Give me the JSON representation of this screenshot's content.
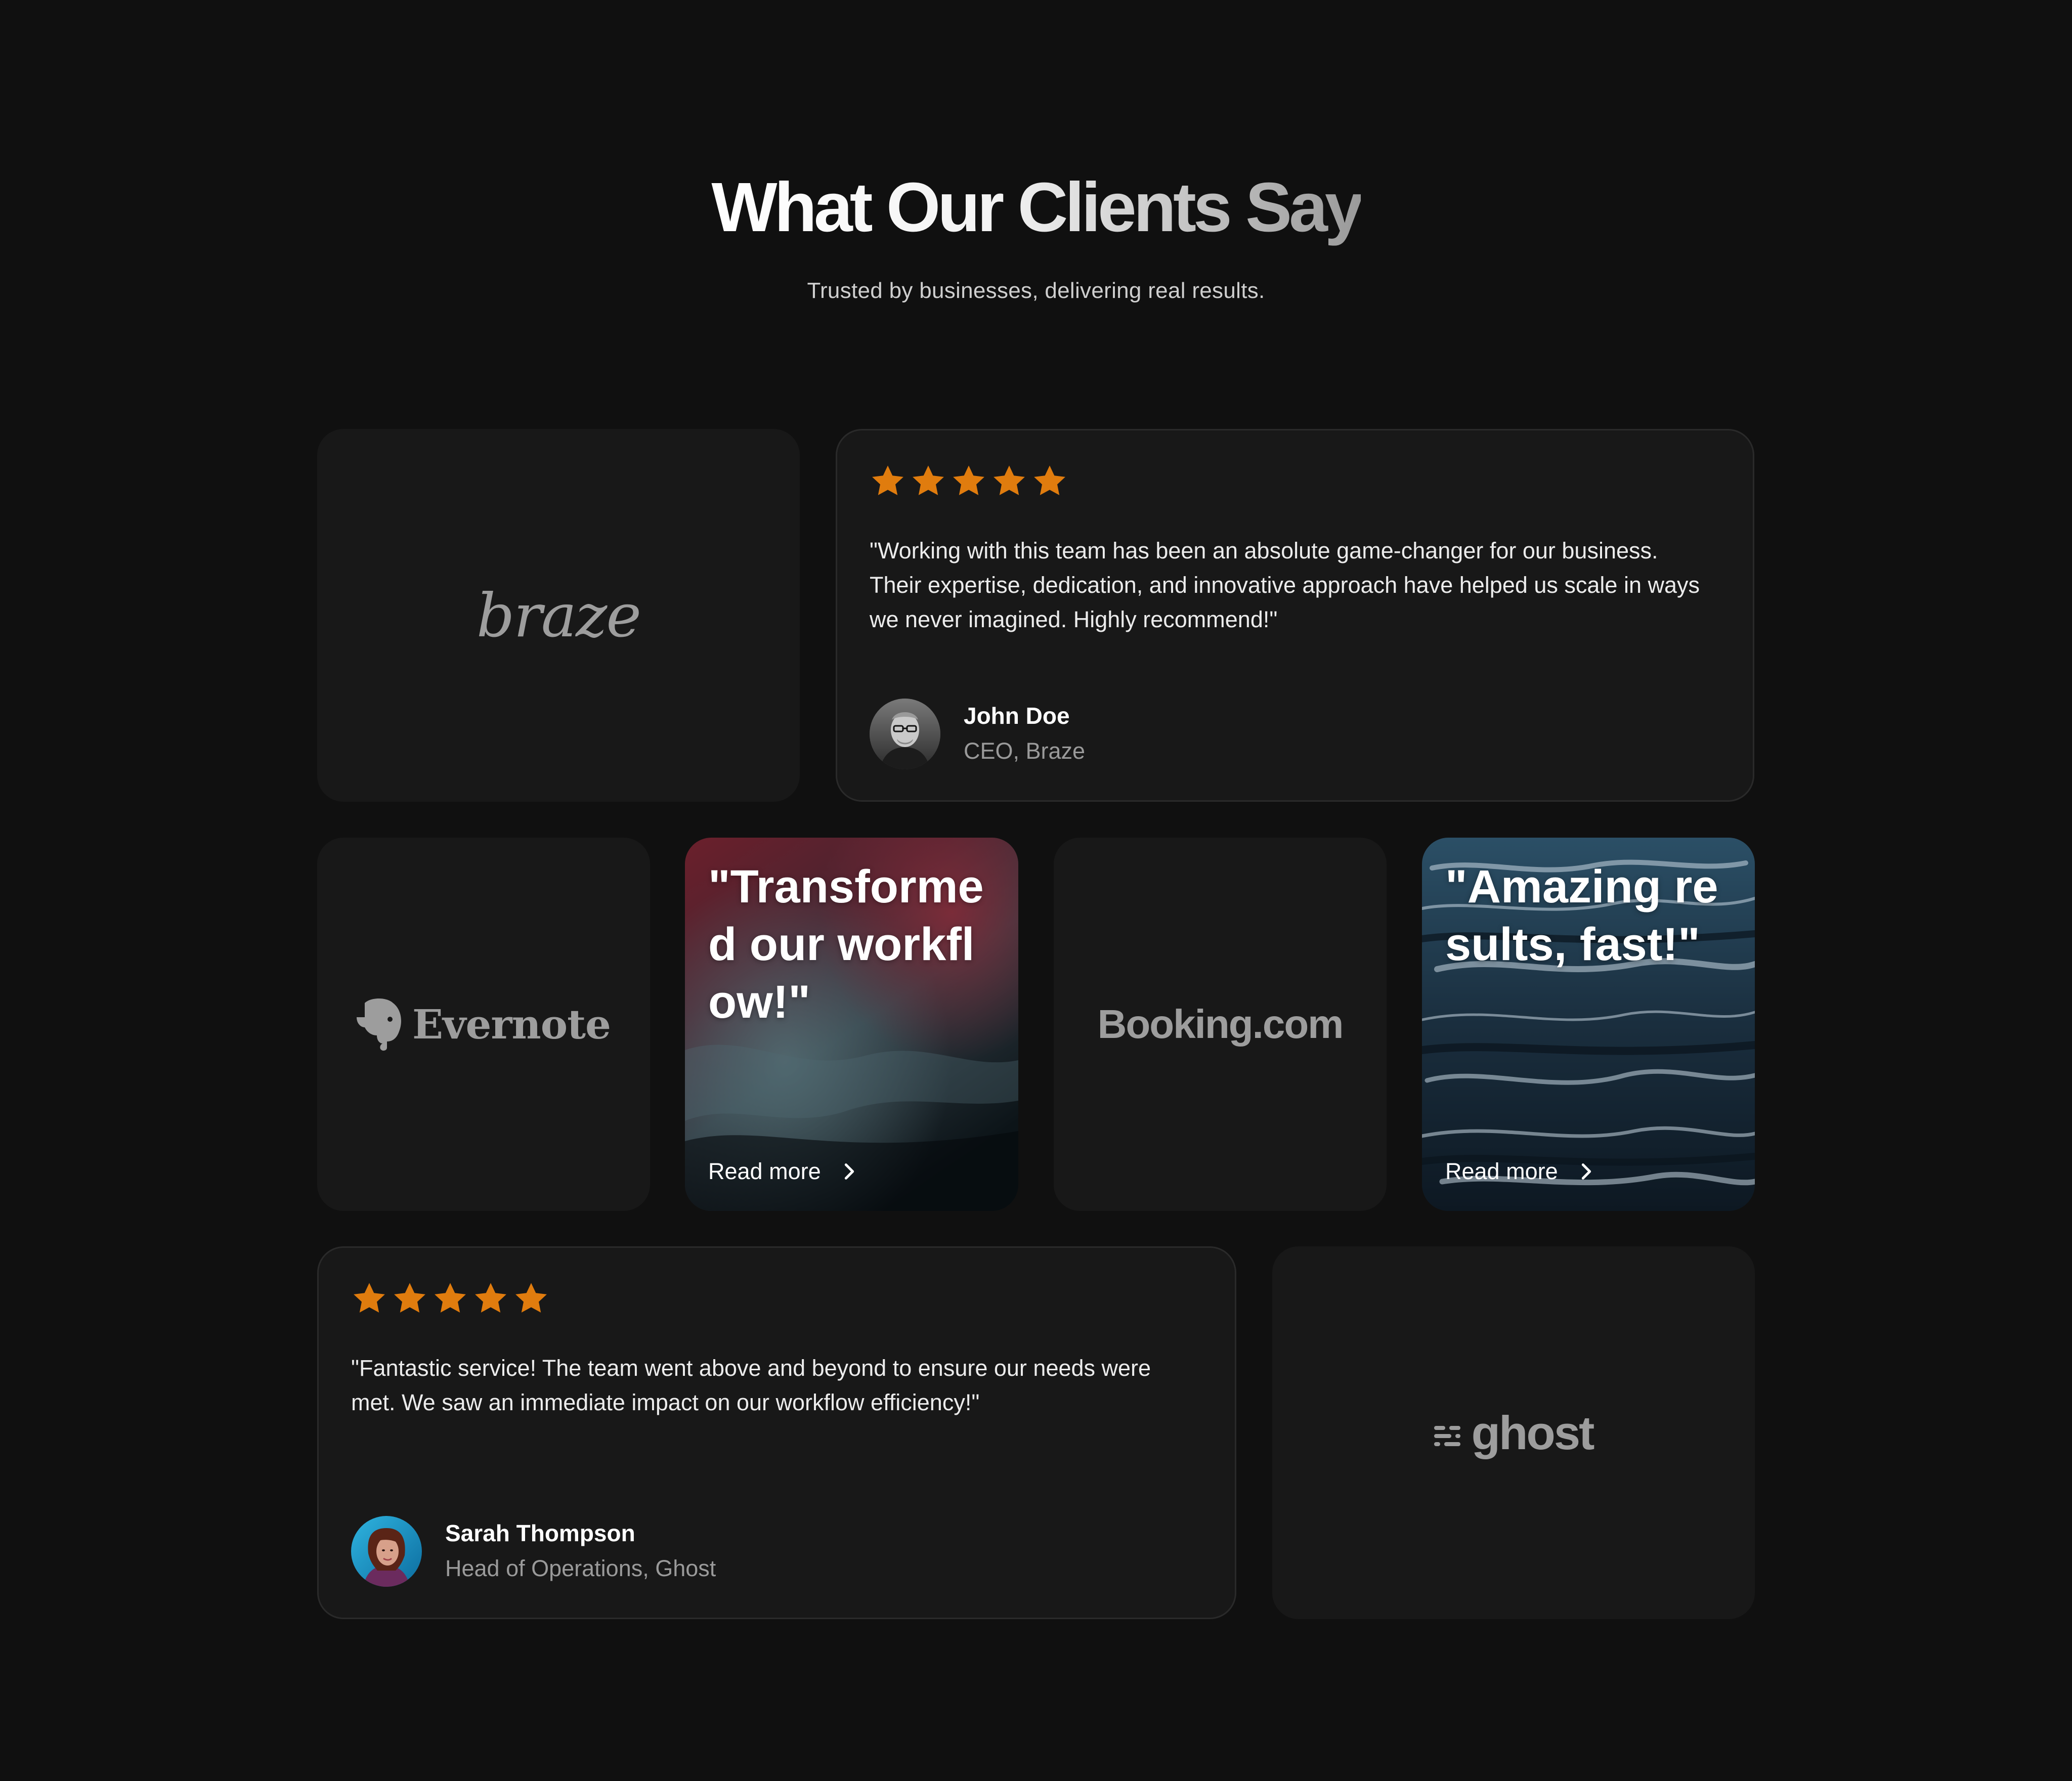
{
  "header": {
    "title": "What Our Clients Say",
    "subtitle": "Trusted by businesses, delivering real results."
  },
  "logos": {
    "braze": "braze",
    "evernote": "Evernote",
    "booking": "Booking.com",
    "ghost": "ghost"
  },
  "testimonials": [
    {
      "rating": 5,
      "quote": "\"Working with this team has been an absolute game-changer for our business. Their expertise, dedication, and innovative approach have helped us scale in ways we never imagined. Highly recommend!\"",
      "name": "John Doe",
      "role": "CEO, Braze"
    },
    {
      "rating": 5,
      "quote": "\"Fantastic service! The team went above and beyond to ensure our needs were met. We saw an immediate impact on our workflow efficiency!\"",
      "name": "Sarah Thompson",
      "role": "Head of Operations, Ghost"
    }
  ],
  "image_cards": [
    {
      "headline": "\"Transformed our workflow!\"",
      "cta": "Read more"
    },
    {
      "headline": "\"Amazing results, fast!\"",
      "cta": "Read more"
    }
  ],
  "colors": {
    "background": "#101010",
    "card": "#181818",
    "star": "#e07c0e",
    "logo": "#9d9d9d"
  },
  "icons": [
    "star-icon",
    "chevron-right-icon",
    "evernote-elephant-icon",
    "ghost-bars-icon"
  ]
}
